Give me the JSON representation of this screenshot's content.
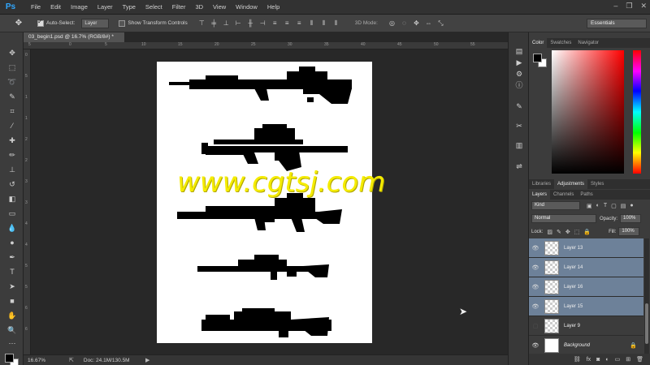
{
  "app": {
    "logo": "Ps"
  },
  "menu": [
    "File",
    "Edit",
    "Image",
    "Layer",
    "Type",
    "Select",
    "Filter",
    "3D",
    "View",
    "Window",
    "Help"
  ],
  "window_controls": {
    "minimize": "–",
    "restore": "❐",
    "close": "✕"
  },
  "options_bar": {
    "auto_select_label": "Auto-Select:",
    "auto_select_value": "Layer",
    "show_transform_label": "Show Transform Controls",
    "mode_3d_label": "3D Mode:",
    "workspace": "Essentials"
  },
  "document": {
    "tab_title": "03_begin1.psd @ 16.7% (RGB/8#) *",
    "watermark": "www.cgtsj.com"
  },
  "status": {
    "zoom": "16.67%",
    "doc_info": "Doc: 24.1M/130.5M"
  },
  "ruler_top": [
    "5",
    "0",
    "5",
    "10",
    "15",
    "20",
    "25",
    "30",
    "35",
    "40",
    "45",
    "50",
    "55"
  ],
  "ruler_left": [
    "0",
    "5",
    "1",
    "1",
    "2",
    "2",
    "3",
    "3",
    "4",
    "4",
    "5",
    "5",
    "6",
    "6"
  ],
  "color_panel": {
    "tabs": [
      "Color",
      "Swatches",
      "Navigator"
    ],
    "fg_color": "#000000",
    "bg_color": "#ffffff"
  },
  "adjustments_panel": {
    "tabs": [
      "Libraries",
      "Adjustments",
      "Styles"
    ]
  },
  "layers_panel": {
    "tabs": [
      "Layers",
      "Channels",
      "Paths"
    ],
    "filter_kind": "Kind",
    "blend_mode": "Normal",
    "opacity_label": "Opacity:",
    "opacity_value": "100%",
    "lock_label": "Lock:",
    "fill_label": "Fill:",
    "fill_value": "100%",
    "layers": [
      {
        "name": "Layer 13",
        "visible": true,
        "selected": true
      },
      {
        "name": "Layer 14",
        "visible": true,
        "selected": true
      },
      {
        "name": "Layer 16",
        "visible": true,
        "selected": true
      },
      {
        "name": "Layer 15",
        "visible": true,
        "selected": true
      },
      {
        "name": "Layer 9",
        "visible": false,
        "selected": false
      },
      {
        "name": "Background",
        "visible": true,
        "selected": false,
        "locked": true
      }
    ]
  }
}
